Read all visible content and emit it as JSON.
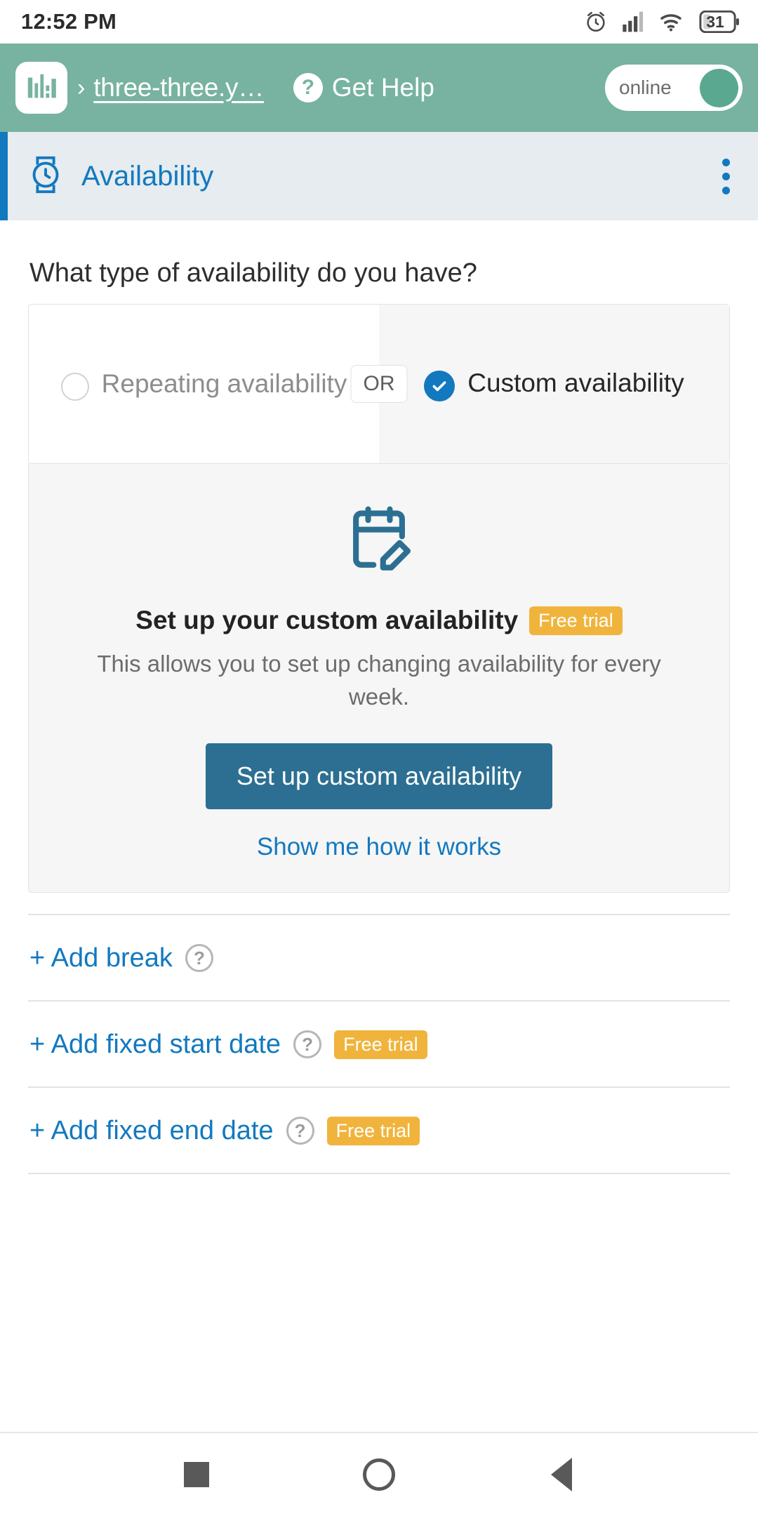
{
  "statusbar": {
    "time": "12:52 PM",
    "battery_level": "31",
    "icons": [
      "alarm-icon",
      "signal-icon",
      "wifi-icon",
      "battery-icon"
    ]
  },
  "appbar": {
    "logo": "bar-chart-logo",
    "separator": "›",
    "breadcrumb": "three-three.y…",
    "help_icon": "?",
    "help_label": "Get Help",
    "toggle_label": "online",
    "toggle_state": "on",
    "background_color": "#77b3a0"
  },
  "section": {
    "icon": "watch-icon",
    "title": "Availability",
    "menu_icon": "kebab-menu-icon",
    "accent_color": "#1279bf",
    "background_color": "#e6ecef"
  },
  "main": {
    "question": "What type of availability do you have?",
    "choices": {
      "or_label": "OR",
      "left": {
        "label": "Repeating availability",
        "selected": false
      },
      "right": {
        "label": "Custom availability",
        "selected": true
      }
    },
    "promo": {
      "icon": "calendar-edit-icon",
      "title": "Set up your custom availability",
      "badge": "Free trial",
      "description": "This allows you to set up changing availability for every week.",
      "button_label": "Set up custom availability",
      "link_label": "Show me how it works",
      "button_color": "#2c6f92",
      "badge_color": "#f0b43c"
    },
    "action_rows": [
      {
        "label": "+ Add break",
        "help_icon": "?",
        "badge": null
      },
      {
        "label": "+ Add fixed start date",
        "help_icon": "?",
        "badge": "Free trial"
      },
      {
        "label": "+ Add fixed end date",
        "help_icon": "?",
        "badge": "Free trial"
      }
    ]
  },
  "navbar": {
    "recents": "square-icon",
    "home": "circle-icon",
    "back": "triangle-back-icon"
  }
}
